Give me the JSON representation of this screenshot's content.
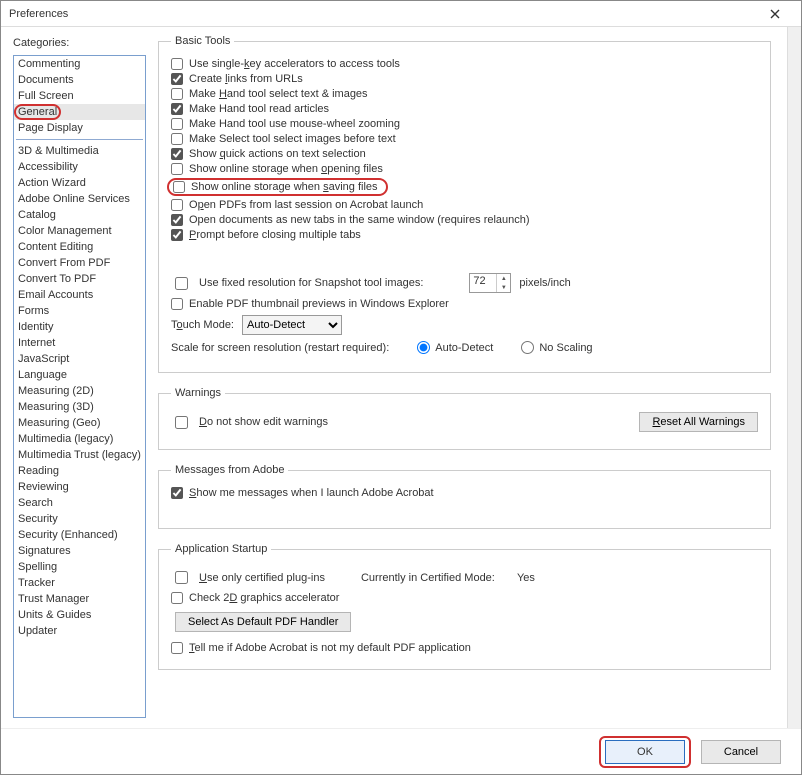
{
  "window": {
    "title": "Preferences"
  },
  "sidebar": {
    "label": "Categories:",
    "top_items": [
      "Commenting",
      "Documents",
      "Full Screen",
      "General",
      "Page Display"
    ],
    "selected": "General",
    "items": [
      "3D & Multimedia",
      "Accessibility",
      "Action Wizard",
      "Adobe Online Services",
      "Catalog",
      "Color Management",
      "Content Editing",
      "Convert From PDF",
      "Convert To PDF",
      "Email Accounts",
      "Forms",
      "Identity",
      "Internet",
      "JavaScript",
      "Language",
      "Measuring (2D)",
      "Measuring (3D)",
      "Measuring (Geo)",
      "Multimedia (legacy)",
      "Multimedia Trust (legacy)",
      "Reading",
      "Reviewing",
      "Search",
      "Security",
      "Security (Enhanced)",
      "Signatures",
      "Spelling",
      "Tracker",
      "Trust Manager",
      "Units & Guides",
      "Updater"
    ]
  },
  "basic": {
    "legend": "Basic Tools",
    "opts": {
      "single_key": {
        "label": "Use single-key accelerators to access tools",
        "checked": false
      },
      "links_urls": {
        "label": "Create links from URLs",
        "checked": true
      },
      "hand_select": {
        "label": "Make Hand tool select text & images",
        "checked": false
      },
      "hand_read": {
        "label": "Make Hand tool read articles",
        "checked": true
      },
      "hand_wheel": {
        "label": "Make Hand tool use mouse-wheel zooming",
        "checked": false
      },
      "select_img": {
        "label": "Make Select tool select images before text",
        "checked": false
      },
      "quick_actions": {
        "label": "Show quick actions on text selection",
        "checked": true
      },
      "storage_open": {
        "label": "Show online storage when opening files",
        "checked": false
      },
      "storage_save": {
        "label": "Show online storage when saving files",
        "checked": false
      },
      "open_last": {
        "label": "Open PDFs from last session on Acrobat launch",
        "checked": false
      },
      "tabs_same": {
        "label": "Open documents as new tabs in the same window (requires relaunch)",
        "checked": true
      },
      "prompt_close": {
        "label": "Prompt before closing multiple tabs",
        "checked": true
      }
    },
    "snap": {
      "label": "Use fixed resolution for Snapshot tool images:",
      "checked": false,
      "value": "72",
      "unit": "pixels/inch"
    },
    "thumbs": {
      "label": "Enable PDF thumbnail previews in Windows Explorer",
      "checked": false
    },
    "touch": {
      "label": "Touch Mode:",
      "value": "Auto-Detect"
    },
    "scale": {
      "label": "Scale for screen resolution (restart required):",
      "auto": "Auto-Detect",
      "none": "No Scaling",
      "selected": "auto"
    }
  },
  "warnings": {
    "legend": "Warnings",
    "no_edit": {
      "label": "Do not show edit warnings",
      "checked": false
    },
    "reset_btn": "Reset All Warnings"
  },
  "adobe_msg": {
    "legend": "Messages from Adobe",
    "show": {
      "label": "Show me messages when I launch Adobe Acrobat",
      "checked": true
    }
  },
  "startup": {
    "legend": "Application Startup",
    "cert": {
      "label": "Use only certified plug-ins",
      "checked": false
    },
    "cert_mode_label": "Currently in Certified Mode:",
    "cert_mode_value": "Yes",
    "gfx": {
      "label": "Check 2D graphics accelerator",
      "checked": false
    },
    "default_btn": "Select As Default PDF Handler",
    "tell": {
      "label": "Tell me if Adobe Acrobat is not my default PDF application",
      "checked": false
    }
  },
  "footer": {
    "ok": "OK",
    "cancel": "Cancel"
  }
}
